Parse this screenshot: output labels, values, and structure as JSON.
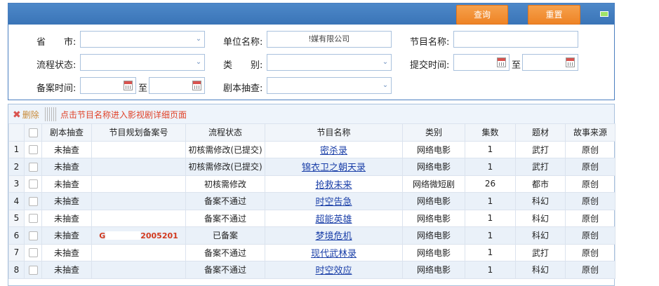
{
  "search": {
    "query_button": "查询",
    "reset_button": "重置",
    "labels": {
      "province": "省　　市:",
      "unit_name": "单位名称:",
      "program_name": "节目名称:",
      "process_status": "流程状态:",
      "category": "类　　别:",
      "submit_time": "提交时间:",
      "record_time": "备案时间:",
      "script_check": "剧本抽查:",
      "to": "至"
    },
    "values": {
      "province": "",
      "unit_name": "ǃ媒有限公司",
      "program_name": "",
      "process_status": "",
      "category": "",
      "submit_time_from": "",
      "submit_time_to": "",
      "record_time_from": "",
      "record_time_to": "",
      "script_check": ""
    }
  },
  "toolbar": {
    "delete_label": "删除",
    "hint": "点击节目名称进入影视剧详细页面"
  },
  "table": {
    "headers": [
      "",
      "剧本抽查",
      "节目规划备案号",
      "流程状态",
      "节目名称",
      "类别",
      "集数",
      "题材",
      "故事来源"
    ],
    "rows": [
      {
        "no": "1",
        "check": "未抽查",
        "rec_prefix": "",
        "rec_suffix": "",
        "status": "初核需修改(已提交)",
        "name": "密杀录",
        "type": "网络电影",
        "eps": "1",
        "theme": "武打",
        "source": "原创"
      },
      {
        "no": "2",
        "check": "未抽查",
        "rec_prefix": "",
        "rec_suffix": "",
        "status": "初核需修改(已提交)",
        "name": "锦衣卫之朝天录",
        "type": "网络电影",
        "eps": "1",
        "theme": "武打",
        "source": "原创"
      },
      {
        "no": "3",
        "check": "未抽查",
        "rec_prefix": "",
        "rec_suffix": "",
        "status": "初核需修改",
        "name": "抢救未来",
        "type": "网络微短剧",
        "eps": "26",
        "theme": "都市",
        "source": "原创"
      },
      {
        "no": "4",
        "check": "未抽查",
        "rec_prefix": "",
        "rec_suffix": "",
        "status": "备案不通过",
        "name": "时空告急",
        "type": "网络电影",
        "eps": "1",
        "theme": "科幻",
        "source": "原创"
      },
      {
        "no": "5",
        "check": "未抽查",
        "rec_prefix": "",
        "rec_suffix": "",
        "status": "备案不通过",
        "name": "超能英雄",
        "type": "网络电影",
        "eps": "1",
        "theme": "科幻",
        "source": "原创"
      },
      {
        "no": "6",
        "check": "未抽查",
        "rec_prefix": "G",
        "rec_suffix": "2005201",
        "status": "已备案",
        "name": "梦境危机",
        "type": "网络电影",
        "eps": "1",
        "theme": "科幻",
        "source": "原创"
      },
      {
        "no": "7",
        "check": "未抽查",
        "rec_prefix": "",
        "rec_suffix": "",
        "status": "备案不通过",
        "name": "现代武林录",
        "type": "网络电影",
        "eps": "1",
        "theme": "武打",
        "source": "原创"
      },
      {
        "no": "8",
        "check": "未抽查",
        "rec_prefix": "",
        "rec_suffix": "",
        "status": "备案不通过",
        "name": "时空效应",
        "type": "网络电影",
        "eps": "1",
        "theme": "科幻",
        "source": "原创"
      }
    ]
  }
}
